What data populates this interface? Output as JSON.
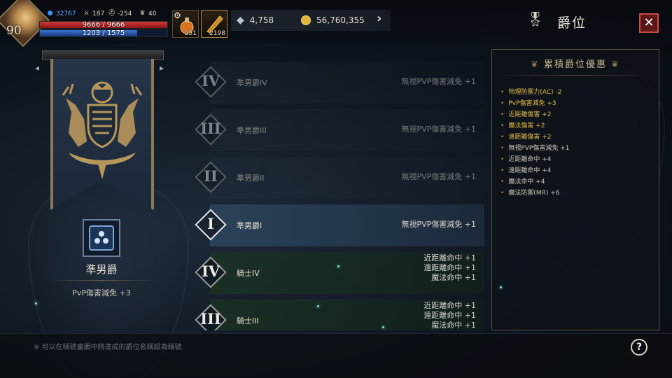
{
  "topbar": {
    "level": "90",
    "stats": [
      {
        "icon": "mana-gem-icon",
        "value": "32767"
      },
      {
        "icon": "sword-icon",
        "value": "187"
      },
      {
        "icon": "helmet-icon",
        "value": "-254"
      },
      {
        "icon": "trophy-icon",
        "value": "40"
      }
    ],
    "hp": {
      "text": "9666 / 9666",
      "fill_fraction": 1.0
    },
    "mp": {
      "text": "1203 / 1575",
      "fill_fraction": 0.764
    },
    "slot1_count": "251",
    "slot2_count": "2198",
    "diamonds": "4,758",
    "gold": "56,760,355",
    "title": "爵位",
    "close_label": "✕"
  },
  "left": {
    "rank_name": "準男爵",
    "rank_benefit": "PvP傷害減免 +3"
  },
  "ranks": [
    {
      "numeral": "IV",
      "name": "準男爵IV",
      "bonuses": [
        "無視PVP傷害減免 +1"
      ],
      "state": "dim"
    },
    {
      "numeral": "III",
      "name": "準男爵III",
      "bonuses": [
        "無視PVP傷害減免 +1"
      ],
      "state": "dim"
    },
    {
      "numeral": "II",
      "name": "準男爵II",
      "bonuses": [
        "無視PVP傷害減免 +1"
      ],
      "state": "dim"
    },
    {
      "numeral": "I",
      "name": "準男爵I",
      "bonuses": [
        "無視PVP傷害減免 +1"
      ],
      "state": "active"
    },
    {
      "numeral": "IV",
      "name": "騎士IV",
      "bonuses": [
        "近距離命中 +1",
        "遠距離命中 +1",
        "魔法命中 +1"
      ],
      "state": "knight"
    },
    {
      "numeral": "III",
      "name": "騎士III",
      "bonuses": [
        "近距離命中 +1",
        "遠距離命中 +1",
        "魔法命中 +1"
      ],
      "state": "knight"
    }
  ],
  "right_panel": {
    "title": "累積爵位優惠",
    "items": [
      {
        "text": "物理防禦力(AC) -2",
        "highlight": true
      },
      {
        "text": "PvP傷害減免 +3",
        "highlight": true
      },
      {
        "text": "近距離傷害 +2",
        "highlight": true
      },
      {
        "text": "魔法傷害 +2",
        "highlight": true
      },
      {
        "text": "遠距離傷害 +2",
        "highlight": true
      },
      {
        "text": "無視PVP傷害減免 +1",
        "highlight": false
      },
      {
        "text": "近距離命中 +4",
        "highlight": false
      },
      {
        "text": "遠距離命中 +4",
        "highlight": false
      },
      {
        "text": "魔法命中 +4",
        "highlight": false
      },
      {
        "text": "魔法防禦(MR) +6",
        "highlight": false
      }
    ]
  },
  "footer": {
    "note": "※ 可以在稱號畫面中將達成的爵位名稱設為稱號.",
    "help_label": "?"
  }
}
